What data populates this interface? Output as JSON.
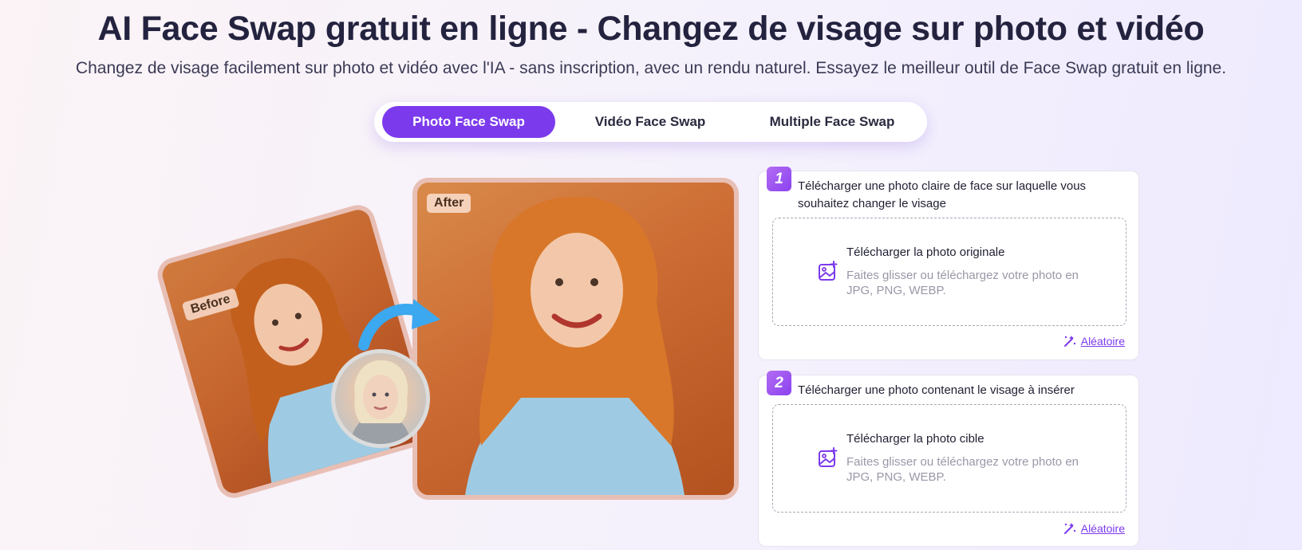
{
  "header": {
    "title": "AI Face Swap gratuit en ligne - Changez de visage sur photo et vidéo",
    "subtitle": "Changez de visage facilement sur photo et vidéo avec l'IA - sans inscription, avec un rendu naturel. Essayez le meilleur outil de Face Swap gratuit en ligne."
  },
  "tabs": [
    {
      "label": "Photo Face Swap",
      "active": true
    },
    {
      "label": "Vidéo Face Swap",
      "active": false
    },
    {
      "label": "Multiple Face Swap",
      "active": false
    }
  ],
  "illustration": {
    "before_label": "Before",
    "after_label": "After"
  },
  "steps": [
    {
      "number": "1",
      "text": "Télécharger une photo claire de face sur laquelle vous souhaitez changer le visage",
      "drop_title": "Télécharger la photo originale",
      "drop_hint": "Faites glisser ou téléchargez votre photo en JPG, PNG, WEBP.",
      "random_label": "Aléatoire"
    },
    {
      "number": "2",
      "text": "Télécharger une photo contenant le visage à insérer",
      "drop_title": "Télécharger la photo cible",
      "drop_hint": "Faites glisser ou téléchargez votre photo en JPG, PNG, WEBP.",
      "random_label": "Aléatoire"
    }
  ],
  "icons": {
    "upload": "image-plus-icon",
    "random": "magic-wand-icon",
    "arrow": "curved-arrow-icon"
  },
  "colors": {
    "accent": "#7c3aed",
    "arrow": "#3ba8ef"
  }
}
